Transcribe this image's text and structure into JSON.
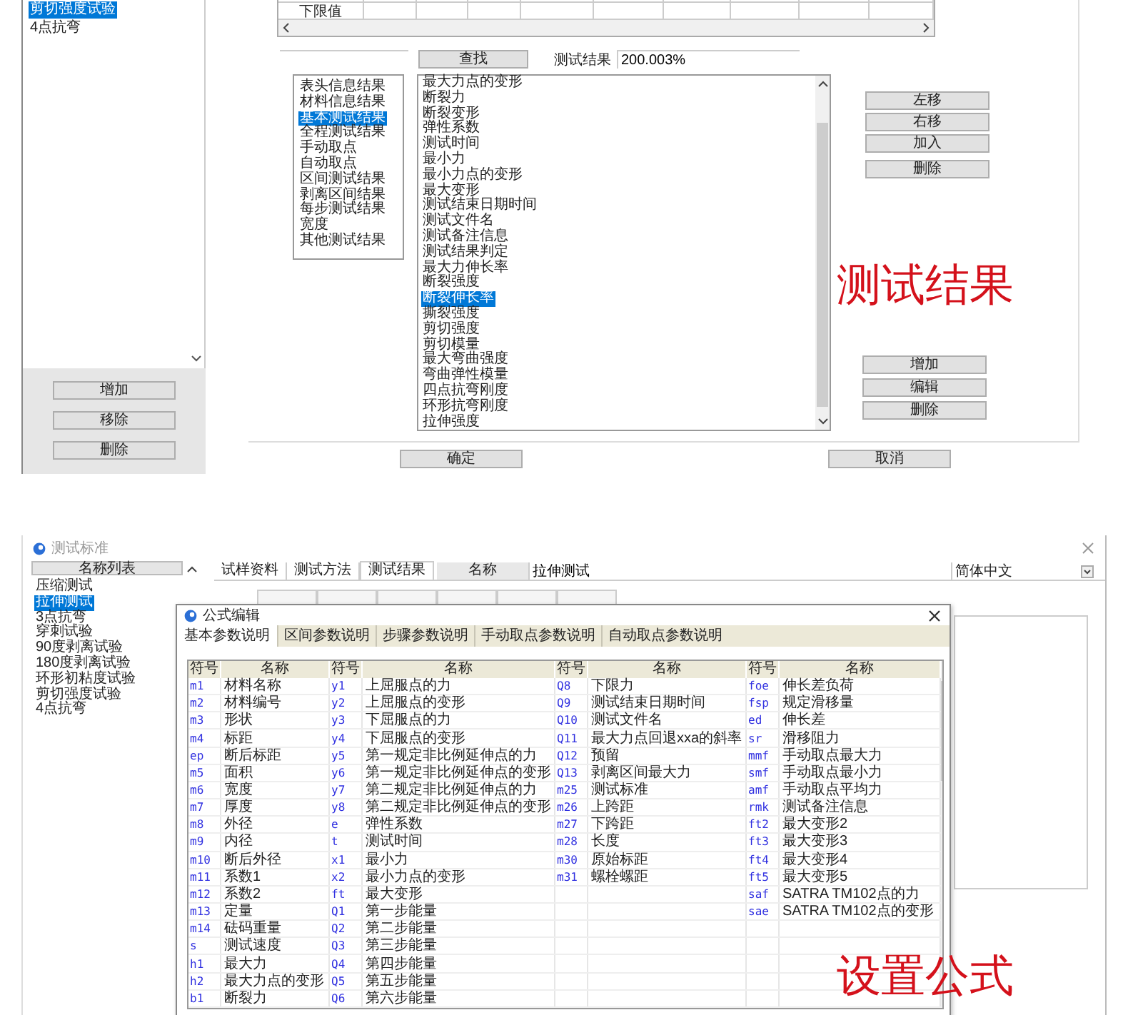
{
  "top_panel": {
    "test_list": [
      {
        "label": "剪切强度试验",
        "selected": true
      },
      {
        "label": "4点抗弯",
        "selected": false
      }
    ],
    "list_buttons": [
      "增加",
      "移除",
      "删除"
    ],
    "limits_table": {
      "row_label": "下限值"
    },
    "search": {
      "button": "查找"
    },
    "result_field": {
      "label": "测试结果",
      "value": "200.003%"
    },
    "categories": [
      {
        "label": "表头信息结果",
        "selected": false
      },
      {
        "label": "材料信息结果",
        "selected": false
      },
      {
        "label": "基本测试结果",
        "selected": true
      },
      {
        "label": "全程测试结果",
        "selected": false
      },
      {
        "label": "手动取点",
        "selected": false
      },
      {
        "label": "自动取点",
        "selected": false
      },
      {
        "label": "区间测试结果",
        "selected": false
      },
      {
        "label": "剥离区间结果",
        "selected": false
      },
      {
        "label": "每步测试结果",
        "selected": false
      },
      {
        "label": "宽度",
        "selected": false
      },
      {
        "label": "其他测试结果",
        "selected": false
      }
    ],
    "results": [
      {
        "label": "最大力点的变形",
        "selected": false
      },
      {
        "label": "断裂力",
        "selected": false
      },
      {
        "label": "断裂变形",
        "selected": false
      },
      {
        "label": "弹性系数",
        "selected": false
      },
      {
        "label": "测试时间",
        "selected": false
      },
      {
        "label": "最小力",
        "selected": false
      },
      {
        "label": "最小力点的变形",
        "selected": false
      },
      {
        "label": "最大变形",
        "selected": false
      },
      {
        "label": "测试结束日期时间",
        "selected": false
      },
      {
        "label": "测试文件名",
        "selected": false
      },
      {
        "label": "测试备注信息",
        "selected": false
      },
      {
        "label": "测试结果判定",
        "selected": false
      },
      {
        "label": "最大力伸长率",
        "selected": false
      },
      {
        "label": "断裂强度",
        "selected": false
      },
      {
        "label": "断裂伸长率",
        "selected": true
      },
      {
        "label": "撕裂强度",
        "selected": false
      },
      {
        "label": "剪切强度",
        "selected": false
      },
      {
        "label": "剪切模量",
        "selected": false
      },
      {
        "label": "最大弯曲强度",
        "selected": false
      },
      {
        "label": "弯曲弹性模量",
        "selected": false
      },
      {
        "label": "四点抗弯刚度",
        "selected": false
      },
      {
        "label": "环形抗弯刚度",
        "selected": false
      },
      {
        "label": "拉伸强度",
        "selected": false
      }
    ],
    "move_buttons": [
      "左移",
      "右移",
      "加入",
      "删除"
    ],
    "edit_buttons": [
      "增加",
      "编辑",
      "删除"
    ],
    "caption": "测试结果",
    "ok_button": "确定",
    "cancel_button": "取消"
  },
  "bottom_panel": {
    "window_title": "测试标准",
    "name_list": {
      "header": "名称列表",
      "items": [
        {
          "label": "压缩测试",
          "selected": false
        },
        {
          "label": "拉伸测试",
          "selected": true
        },
        {
          "label": "3点抗弯",
          "selected": false
        },
        {
          "label": "穿刺试验",
          "selected": false
        },
        {
          "label": "90度剥离试验",
          "selected": false
        },
        {
          "label": "180度剥离试验",
          "selected": false
        },
        {
          "label": "环形初粘度试验",
          "selected": false
        },
        {
          "label": "剪切强度试验",
          "selected": false
        },
        {
          "label": "4点抗弯",
          "selected": false
        }
      ]
    },
    "tabs": [
      {
        "label": "试样资料",
        "selected": false
      },
      {
        "label": "测试方法",
        "selected": false
      },
      {
        "label": "测试结果",
        "selected": true
      }
    ],
    "name_field": {
      "label": "名称",
      "value": "拉伸测试"
    },
    "language": "简体中文",
    "dialog": {
      "title": "公式编辑",
      "tabs": [
        {
          "label": "基本参数说明",
          "selected": true
        },
        {
          "label": "区间参数说明",
          "selected": false
        },
        {
          "label": "步骤参数说明",
          "selected": false
        },
        {
          "label": "手动取点参数说明",
          "selected": false
        },
        {
          "label": "自动取点参数说明",
          "selected": false
        }
      ],
      "columns": [
        "符号",
        "名称",
        "符号",
        "名称",
        "符号",
        "名称",
        "符号",
        "名称"
      ],
      "rows": [
        [
          "m1",
          "材料名称",
          "y1",
          "上屈服点的力",
          "Q8",
          "下限力",
          "foe",
          "伸长差负荷"
        ],
        [
          "m2",
          "材料编号",
          "y2",
          "上屈服点的变形",
          "Q9",
          "测试结束日期时间",
          "fsp",
          "规定滑移量"
        ],
        [
          "m3",
          "形状",
          "y3",
          "下屈服点的力",
          "Q10",
          "测试文件名",
          "ed",
          "伸长差"
        ],
        [
          "m4",
          "标距",
          "y4",
          "下屈服点的变形",
          "Q11",
          "最大力点回退xxa的斜率",
          "sr",
          "滑移阻力"
        ],
        [
          "ep",
          "断后标距",
          "y5",
          "第一规定非比例延伸点的力",
          "Q12",
          "预留",
          "mmf",
          "手动取点最大力"
        ],
        [
          "m5",
          "面积",
          "y6",
          "第一规定非比例延伸点的变形",
          "Q13",
          "剥离区间最大力",
          "smf",
          "手动取点最小力"
        ],
        [
          "m6",
          "宽度",
          "y7",
          "第二规定非比例延伸点的力",
          "m25",
          "测试标准",
          "amf",
          "手动取点平均力"
        ],
        [
          "m7",
          "厚度",
          "y8",
          "第二规定非比例延伸点的变形",
          "m26",
          "上跨距",
          "rmk",
          "测试备注信息"
        ],
        [
          "m8",
          "外径",
          "e",
          "弹性系数",
          "m27",
          "下跨距",
          "ft2",
          "最大变形2"
        ],
        [
          "m9",
          "内径",
          "t",
          "测试时间",
          "m28",
          "长度",
          "ft3",
          "最大变形3"
        ],
        [
          "m10",
          "断后外径",
          "x1",
          "最小力",
          "m30",
          "原始标距",
          "ft4",
          "最大变形4"
        ],
        [
          "m11",
          "系数1",
          "x2",
          "最小力点的变形",
          "m31",
          "螺栓螺距",
          "ft5",
          "最大变形5"
        ],
        [
          "m12",
          "系数2",
          "ft",
          "最大变形",
          "",
          "",
          "saf",
          "SATRA TM102点的力"
        ],
        [
          "m13",
          "定量",
          "Q1",
          "第一步能量",
          "",
          "",
          "sae",
          "SATRA TM102点的变形"
        ],
        [
          "m14",
          "砝码重量",
          "Q2",
          "第二步能量"
        ],
        [
          "s",
          "测试速度",
          "Q3",
          "第三步能量"
        ],
        [
          "h1",
          "最大力",
          "Q4",
          "第四步能量"
        ],
        [
          "h2",
          "最大力点的变形",
          "Q5",
          "第五步能量"
        ],
        [
          "b1",
          "断裂力",
          "Q6",
          "第六步能量"
        ]
      ]
    },
    "caption": "设置公式"
  }
}
